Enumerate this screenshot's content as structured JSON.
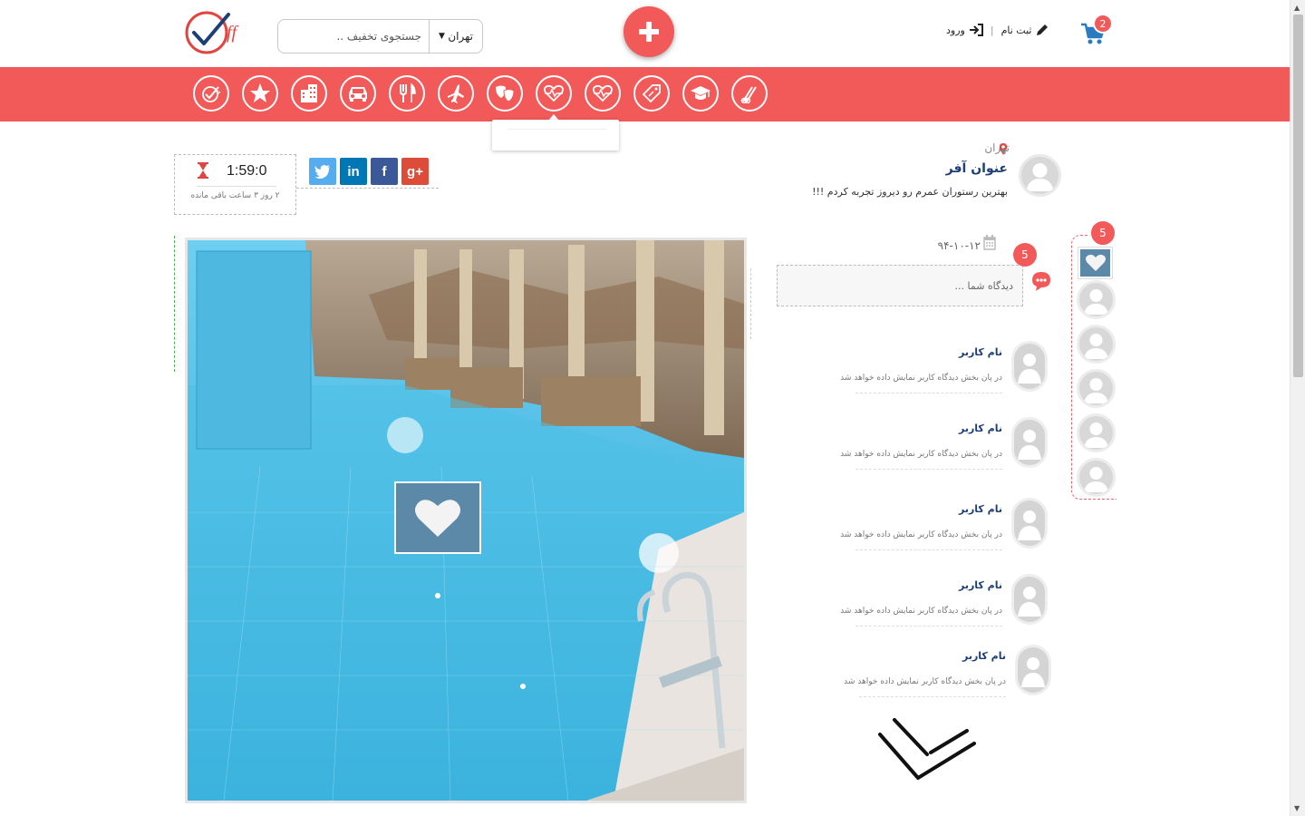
{
  "header": {
    "logo_text": "ff",
    "search": {
      "city": "تهران",
      "placeholder": "جستجوی تخفیف .."
    },
    "cart_count": "2",
    "auth": {
      "login": "ورود",
      "register": "ثبت نام"
    },
    "add_icon": "plus-icon"
  },
  "categories": [
    {
      "name": "hairdresser"
    },
    {
      "name": "education"
    },
    {
      "name": "discount-tag"
    },
    {
      "name": "health"
    },
    {
      "name": "medical"
    },
    {
      "name": "theater"
    },
    {
      "name": "travel"
    },
    {
      "name": "restaurant"
    },
    {
      "name": "car"
    },
    {
      "name": "hotel"
    },
    {
      "name": "favorites"
    },
    {
      "name": "offer-check"
    }
  ],
  "timer": {
    "time": "1:59:0",
    "remaining": "۲ روز ۳ ساعت باقی مانده"
  },
  "share": {
    "twitter": "twitter",
    "linkedin": "in",
    "facebook": "f",
    "googleplus": "g+"
  },
  "offer": {
    "location": "تهران",
    "title": "عنوان آفر",
    "description": "بهترین رستوران عمرم رو دیروز تجربه کردم !!!"
  },
  "comments_section": {
    "date": "۹۴-۱۰-۱۲",
    "comment_count": "5",
    "input_placeholder": "دیدگاه شما ...",
    "comments": [
      {
        "name": "نام کاربر",
        "text": "در پان بخش دیدگاه کاربر نمایش داده خواهد شد"
      },
      {
        "name": "نام کاربر",
        "text": "در پان بخش دیدگاه کاربر نمایش داده خواهد شد"
      },
      {
        "name": "نام کاربر",
        "text": "در پان بخش دیدگاه کاربر نمایش داده خواهد شد"
      },
      {
        "name": "نام کاربر",
        "text": "در پان بخش دیدگاه کاربر نمایش داده خواهد شد"
      },
      {
        "name": "نام کاربر",
        "text": "در پان بخش دیدگاه کاربر نمایش داده خواهد شد"
      }
    ]
  },
  "likers": {
    "count": "5"
  },
  "colors": {
    "brand": "#f25a5a",
    "title": "#1d3f76",
    "twitter": "#55acee",
    "linkedin": "#0077b5",
    "facebook": "#3b5998",
    "googleplus": "#dd4b39"
  }
}
